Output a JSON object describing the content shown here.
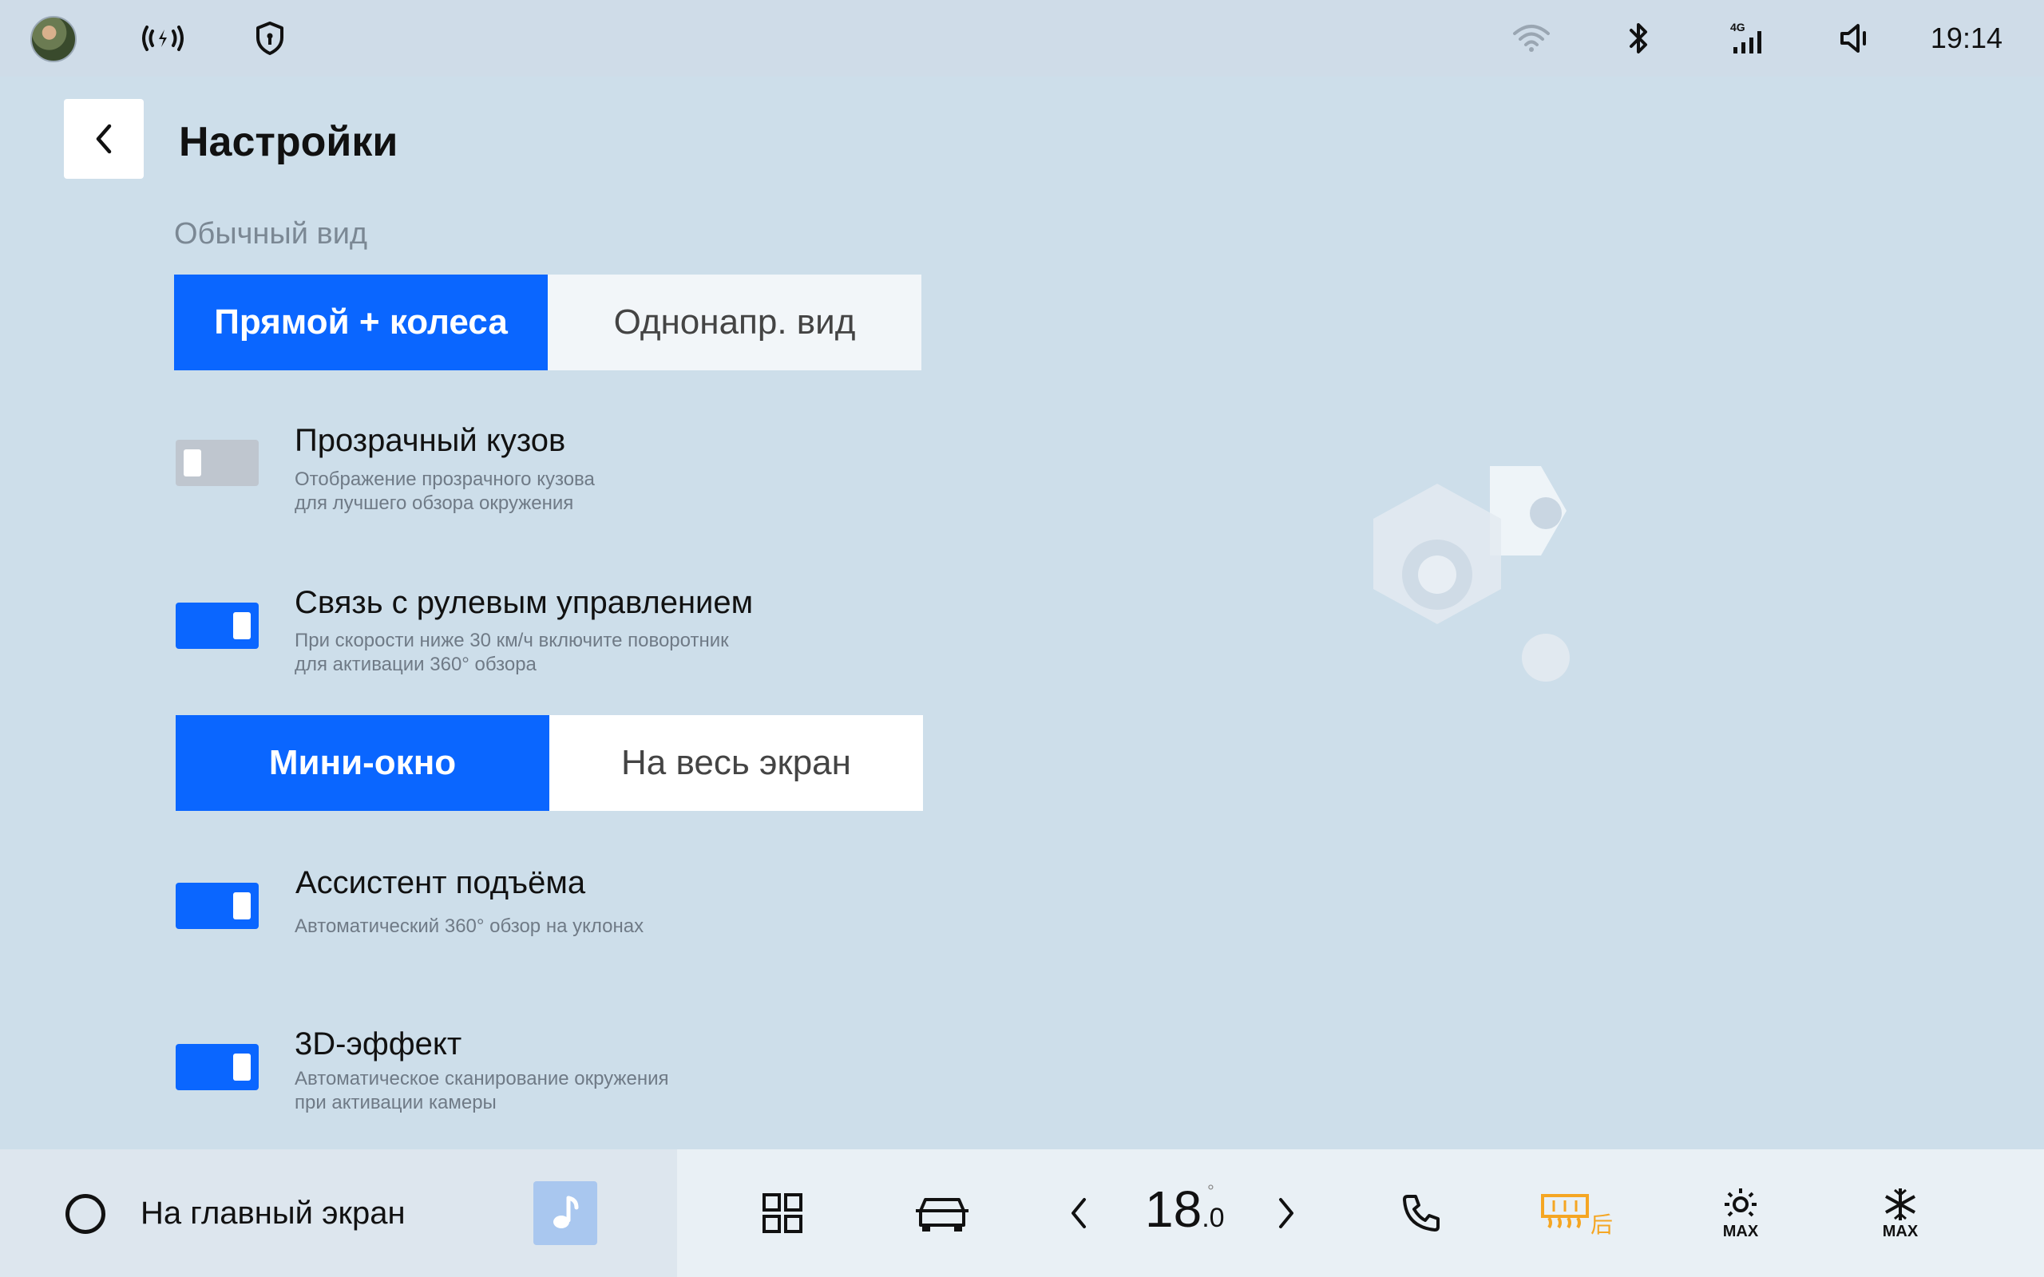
{
  "status_bar": {
    "time": "19:14",
    "network_label": "4G",
    "icons": [
      "avatar",
      "wireless-charging-icon",
      "shield-icon",
      "wifi-icon",
      "bluetooth-icon",
      "cellular-4g-icon",
      "volume-muted-icon"
    ]
  },
  "header": {
    "title": "Настройки",
    "back_icon": "chevron-left-icon"
  },
  "normal_view": {
    "label": "Обычный вид",
    "options": [
      "Прямой + колеса",
      "Однонапр. вид"
    ],
    "selected_index": 0
  },
  "settings": [
    {
      "title": "Прозрачный кузов",
      "desc1": "Отображение прозрачного кузова",
      "desc2": "для лучшего обзора окружения",
      "enabled": false
    },
    {
      "title": "Связь с рулевым управлением",
      "desc1": "При скорости ниже 30 км/ч включите поворотник",
      "desc2": "для активации 360° обзора",
      "enabled": true
    },
    {
      "title": "Ассистент подъёма",
      "desc1": "Автоматический 360° обзор на уклонах",
      "desc2": "",
      "enabled": true
    },
    {
      "title": "3D-эффект",
      "desc1": "Автоматическое сканирование окружения",
      "desc2": "при активации камеры",
      "enabled": true
    }
  ],
  "window_mode": {
    "options": [
      "Мини-окно",
      "На весь экран"
    ],
    "selected_index": 0
  },
  "bottom_bar": {
    "home_label": "На главный экран",
    "temperature_int": "18",
    "temperature_dec": ".0",
    "temperature_unit": "°",
    "rear_defrost_label": "后",
    "max_label_1": "MAX",
    "max_label_2": "MAX",
    "accent_color": "#0a66ff",
    "defrost_color": "#f5a623"
  }
}
